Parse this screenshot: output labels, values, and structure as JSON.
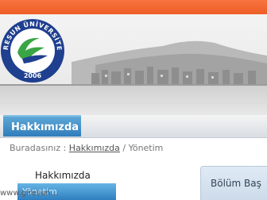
{
  "logo": {
    "arc_text": "GİRESUN ÜNİVERSİTESİ",
    "year": "2006"
  },
  "navbar": {
    "active_label": "Hakkımızda"
  },
  "breadcrumb": {
    "prefix": "Buradasınız :",
    "link": "Hakkımızda",
    "separator": " / ",
    "current": "Yönetim"
  },
  "sidebar": {
    "title": "Hakkımızda",
    "active_item": "Yönetim",
    "watermark": "www.giresun..."
  },
  "content": {
    "title": "Bölüm Baş"
  },
  "colors": {
    "topbar": "#ee5e26",
    "nav_active": "#2f7dbb",
    "logo_blue": "#1f3f8f",
    "logo_green": "#3aa544"
  }
}
